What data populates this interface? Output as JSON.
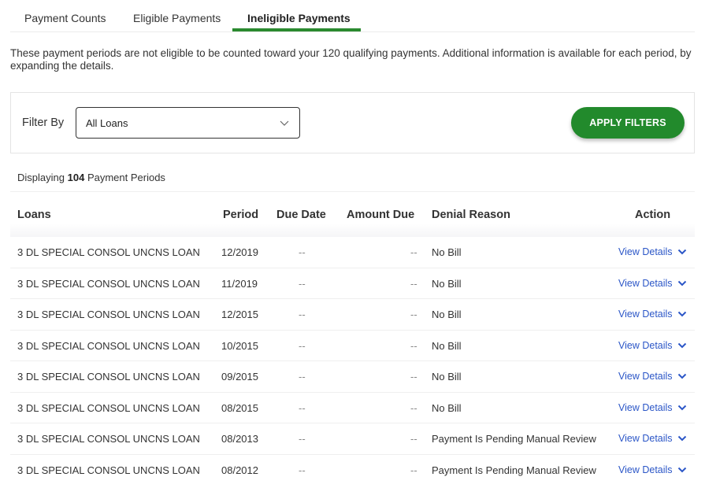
{
  "tabs": [
    {
      "label": "Payment Counts",
      "active": false
    },
    {
      "label": "Eligible Payments",
      "active": false
    },
    {
      "label": "Ineligible Payments",
      "active": true
    }
  ],
  "intro_text": "These payment periods are not eligible to be counted toward your 120 qualifying payments. Additional information is available for each period, by expanding the details.",
  "filter": {
    "label": "Filter By",
    "selected": "All Loans",
    "chevron_icon": "chevron-down-icon",
    "apply_label": "APPLY FILTERS"
  },
  "summary": {
    "prefix": "Displaying",
    "count": "104",
    "suffix": "Payment Periods"
  },
  "colors": {
    "accent_green": "#228a2c",
    "link_blue": "#2b56c7"
  },
  "table": {
    "headers": {
      "loans": "Loans",
      "period": "Period",
      "due_date": "Due Date",
      "amount_due": "Amount Due",
      "denial_reason": "Denial Reason",
      "action": "Action"
    },
    "rows": [
      {
        "loan": "3 DL SPECIAL CONSOL UNCNS LOAN",
        "period": "12/2019",
        "due_date": "--",
        "amount_due": "--",
        "denial_reason": "No Bill",
        "action": "View Details"
      },
      {
        "loan": "3 DL SPECIAL CONSOL UNCNS LOAN",
        "period": "11/2019",
        "due_date": "--",
        "amount_due": "--",
        "denial_reason": "No Bill",
        "action": "View Details"
      },
      {
        "loan": "3 DL SPECIAL CONSOL UNCNS LOAN",
        "period": "12/2015",
        "due_date": "--",
        "amount_due": "--",
        "denial_reason": "No Bill",
        "action": "View Details"
      },
      {
        "loan": "3 DL SPECIAL CONSOL UNCNS LOAN",
        "period": "10/2015",
        "due_date": "--",
        "amount_due": "--",
        "denial_reason": "No Bill",
        "action": "View Details"
      },
      {
        "loan": "3 DL SPECIAL CONSOL UNCNS LOAN",
        "period": "09/2015",
        "due_date": "--",
        "amount_due": "--",
        "denial_reason": "No Bill",
        "action": "View Details"
      },
      {
        "loan": "3 DL SPECIAL CONSOL UNCNS LOAN",
        "period": "08/2015",
        "due_date": "--",
        "amount_due": "--",
        "denial_reason": "No Bill",
        "action": "View Details"
      },
      {
        "loan": "3 DL SPECIAL CONSOL UNCNS LOAN",
        "period": "08/2013",
        "due_date": "--",
        "amount_due": "--",
        "denial_reason": "Payment Is Pending Manual Review",
        "action": "View Details"
      },
      {
        "loan": "3 DL SPECIAL CONSOL UNCNS LOAN",
        "period": "08/2012",
        "due_date": "--",
        "amount_due": "--",
        "denial_reason": "Payment Is Pending Manual Review",
        "action": "View Details"
      }
    ]
  }
}
